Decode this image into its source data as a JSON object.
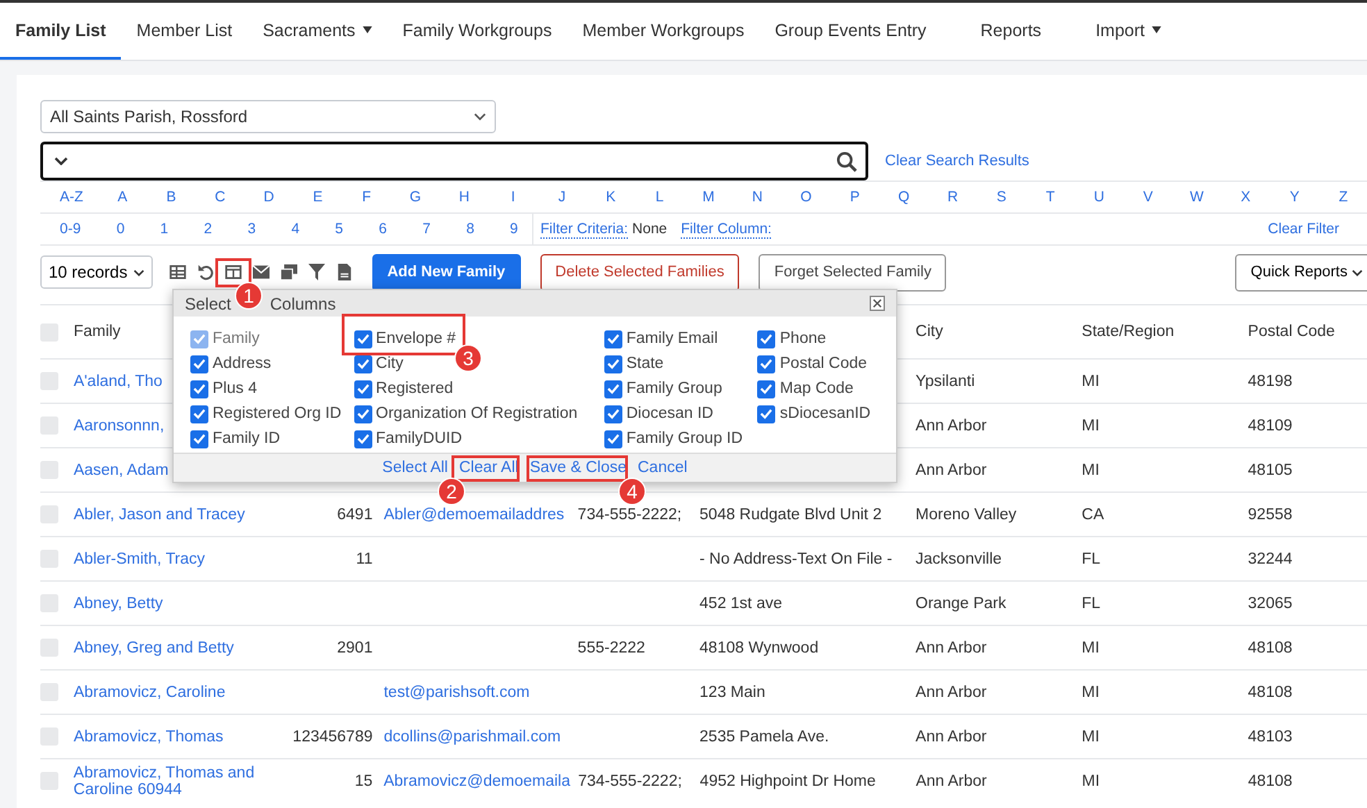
{
  "nav": [
    {
      "label": "Family List",
      "selected": true,
      "dropdown": false
    },
    {
      "label": "Member List",
      "selected": false,
      "dropdown": false
    },
    {
      "label": "Sacraments",
      "selected": false,
      "dropdown": true
    },
    {
      "label": "Family Workgroups",
      "selected": false,
      "dropdown": false
    },
    {
      "label": "Member Workgroups",
      "selected": false,
      "dropdown": false
    },
    {
      "label": "Group Events Entry",
      "selected": false,
      "dropdown": false
    },
    {
      "label": "Reports",
      "selected": false,
      "dropdown": false
    },
    {
      "label": "Import",
      "selected": false,
      "dropdown": true
    }
  ],
  "parish_select": {
    "value": "All Saints Parish, Rossford"
  },
  "search": {
    "clear_link": "Clear Search Results"
  },
  "letters": [
    "A-Z",
    "A",
    "B",
    "C",
    "D",
    "E",
    "F",
    "G",
    "H",
    "I",
    "J",
    "K",
    "L",
    "M",
    "N",
    "O",
    "P",
    "Q",
    "R",
    "S",
    "T",
    "U",
    "V",
    "W",
    "X",
    "Y",
    "Z"
  ],
  "digits": [
    "0-9",
    "0",
    "1",
    "2",
    "3",
    "4",
    "5",
    "6",
    "7",
    "8",
    "9"
  ],
  "filter": {
    "criteria_label": "Filter Criteria:",
    "criteria_value": "None",
    "column_label": "Filter Column:",
    "clear": "Clear Filter"
  },
  "toolbar": {
    "records": "10 records",
    "add": "Add New Family",
    "delete": "Delete Selected Families",
    "forget": "Forget Selected Family",
    "quick_reports": "Quick Reports"
  },
  "table": {
    "select_all_checked": false,
    "columns": [
      "Family",
      "City",
      "State/Region",
      "Postal Code"
    ],
    "rows": [
      {
        "checked": false,
        "family": "A'aland, Tho",
        "envelope": "",
        "email": "",
        "phone": "",
        "address": "",
        "city": "Ypsilanti",
        "state": "MI",
        "postal": "48198"
      },
      {
        "checked": false,
        "family": "Aaronsonnn,",
        "envelope": "",
        "email": "",
        "phone": "",
        "address": "",
        "city": "Ann Arbor",
        "state": "MI",
        "postal": "48109"
      },
      {
        "checked": false,
        "family": "Aasen, Adam",
        "envelope": "",
        "email": "",
        "phone": "",
        "address": "",
        "city": "Ann Arbor",
        "state": "MI",
        "postal": "48105"
      },
      {
        "checked": false,
        "family": "Abler, Jason and Tracey",
        "envelope": "6491",
        "email": "Abler@demoemailaddres",
        "phone": "734-555-2222;",
        "address": "5048 Rudgate Blvd Unit 2",
        "city": "Moreno Valley",
        "state": "CA",
        "postal": "92558"
      },
      {
        "checked": false,
        "family": "Abler-Smith, Tracy",
        "envelope": "11",
        "email": "",
        "phone": "",
        "address": "- No Address-Text On File -",
        "city": "Jacksonville",
        "state": "FL",
        "postal": "32244"
      },
      {
        "checked": false,
        "family": "Abney, Betty",
        "envelope": "",
        "email": "",
        "phone": "",
        "address": "452 1st ave",
        "city": "Orange Park",
        "state": "FL",
        "postal": "32065"
      },
      {
        "checked": false,
        "family": "Abney, Greg and Betty",
        "envelope": "2901",
        "email": "",
        "phone": "555-2222",
        "address": "48108 Wynwood",
        "city": "Ann Arbor",
        "state": "MI",
        "postal": "48108"
      },
      {
        "checked": false,
        "family": "Abramovicz, Caroline",
        "envelope": "",
        "email": "test@parishsoft.com",
        "phone": "",
        "address": "123 Main",
        "city": "Ann Arbor",
        "state": "MI",
        "postal": "48108"
      },
      {
        "checked": false,
        "family": "Abramovicz, Thomas",
        "envelope": "123456789",
        "email": "dcollins@parishmail.com",
        "phone": "",
        "address": "2535 Pamela Ave.",
        "city": "Ann Arbor",
        "state": "MI",
        "postal": "48103"
      },
      {
        "checked": false,
        "family": "Abramovicz, Thomas and Caroline 60944",
        "envelope": "15",
        "email": "Abramovicz@demoemaila",
        "phone": "734-555-2222;",
        "address": "4952 Highpoint Dr Home",
        "city": "Ann Arbor",
        "state": "MI",
        "postal": "48108"
      }
    ]
  },
  "dialog": {
    "title_start": "Select",
    "title_end": "Columns",
    "groups": [
      [
        {
          "label": "Family",
          "checked": true,
          "disabled": true
        },
        {
          "label": "Address",
          "checked": true,
          "disabled": false
        },
        {
          "label": "Plus 4",
          "checked": true,
          "disabled": false
        },
        {
          "label": "Registered Org ID",
          "checked": true,
          "disabled": false
        },
        {
          "label": "Family ID",
          "checked": true,
          "disabled": false
        }
      ],
      [
        {
          "label": "Envelope #",
          "checked": true,
          "disabled": false
        },
        {
          "label": "City",
          "checked": true,
          "disabled": false
        },
        {
          "label": "Registered",
          "checked": true,
          "disabled": false
        },
        {
          "label": "Organization Of Registration",
          "checked": true,
          "disabled": false
        },
        {
          "label": "FamilyDUID",
          "checked": true,
          "disabled": false
        }
      ],
      [
        {
          "label": "Family Email",
          "checked": true,
          "disabled": false
        },
        {
          "label": "State",
          "checked": true,
          "disabled": false
        },
        {
          "label": "Family Group",
          "checked": true,
          "disabled": false
        },
        {
          "label": "Diocesan ID",
          "checked": true,
          "disabled": false
        },
        {
          "label": "Family Group ID",
          "checked": true,
          "disabled": false
        }
      ],
      [
        {
          "label": "Phone",
          "checked": true,
          "disabled": false
        },
        {
          "label": "Postal Code",
          "checked": true,
          "disabled": false
        },
        {
          "label": "Map Code",
          "checked": true,
          "disabled": false
        },
        {
          "label": "sDiocesanID",
          "checked": true,
          "disabled": false
        }
      ]
    ],
    "actions": [
      "Select All",
      "Clear All",
      "Save & Close",
      "Cancel"
    ]
  },
  "annotations": [
    {
      "number": "1"
    },
    {
      "number": "2"
    },
    {
      "number": "3"
    },
    {
      "number": "4"
    }
  ]
}
